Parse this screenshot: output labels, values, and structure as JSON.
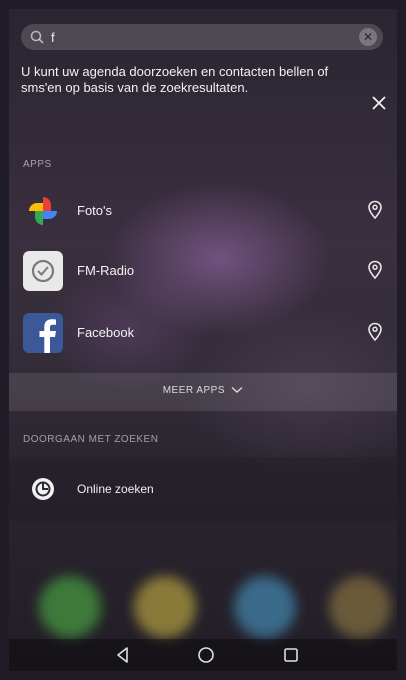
{
  "search": {
    "query": "f",
    "clear_icon": "close-circle-icon",
    "search_icon": "search-icon"
  },
  "hint": {
    "text": "U kunt uw agenda doorzoeken en contacten bellen of sms'en op basis van de zoekresultaten.",
    "close_icon": "close-icon"
  },
  "apps_section": {
    "label": "APPS",
    "items": [
      {
        "label": "Foto's",
        "icon": "photos-pinwheel-icon"
      },
      {
        "label": "FM-Radio",
        "icon": "fm-radio-icon"
      },
      {
        "label": "Facebook",
        "icon": "facebook-icon"
      }
    ],
    "more_label": "MEER APPS"
  },
  "continue_section": {
    "label": "DOORGAAN MET ZOEKEN",
    "online_label": "Online zoeken"
  },
  "colors": {
    "facebook_blue": "#3b5998",
    "pin_gray": "#e8e8e8",
    "photos_red": "#e94235",
    "photos_yellow": "#fbbc04",
    "photos_green": "#34a853",
    "photos_blue": "#4285f4"
  }
}
